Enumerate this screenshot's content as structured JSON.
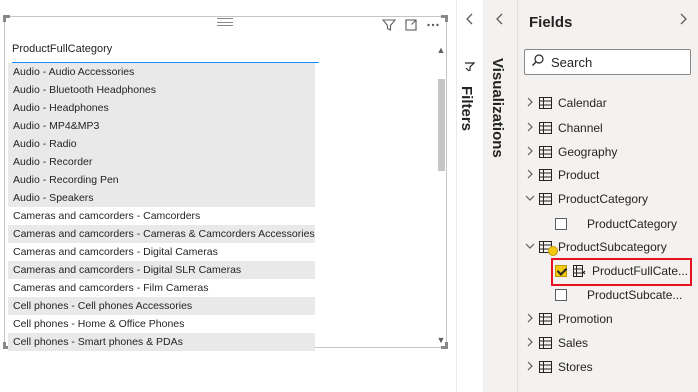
{
  "canvas": {
    "table": {
      "column_header": "ProductFullCategory",
      "rows": [
        "Audio - Audio Accessories",
        "Audio - Bluetooth Headphones",
        "Audio - Headphones",
        "Audio - MP4&MP3",
        "Audio - Radio",
        "Audio - Recorder",
        "Audio - Recording Pen",
        "Audio - Speakers",
        "Cameras and camcorders - Camcorders",
        "Cameras and camcorders - Cameras & Camcorders Accessories",
        "Cameras and camcorders - Digital Cameras",
        "Cameras and camcorders - Digital SLR Cameras",
        "Cameras and camcorders - Film Cameras",
        "Cell phones - Cell phones Accessories",
        "Cell phones - Home & Office Phones",
        "Cell phones - Smart phones & PDAs"
      ]
    },
    "header_icons": [
      "filter-icon",
      "focus-mode-icon",
      "more-options-icon"
    ]
  },
  "filters_pane": {
    "label": "Filters",
    "collapse_icon": "chevron-left-icon"
  },
  "visualizations_pane": {
    "label": "Visualizations",
    "collapse_icon": "chevron-left-icon"
  },
  "fields_pane": {
    "title": "Fields",
    "expand_icon": "chevron-right-icon",
    "search_placeholder": "Search",
    "tables": [
      {
        "name": "Calendar",
        "expanded": false
      },
      {
        "name": "Channel",
        "expanded": false
      },
      {
        "name": "Geography",
        "expanded": false
      },
      {
        "name": "Product",
        "expanded": false
      },
      {
        "name": "ProductCategory",
        "expanded": true,
        "fields": [
          {
            "name": "ProductCategory",
            "checked": false
          }
        ]
      },
      {
        "name": "ProductSubcategory",
        "expanded": true,
        "fields": [
          {
            "name": "ProductFullCate...",
            "checked": true
          },
          {
            "name": "ProductSubcate...",
            "checked": false
          }
        ]
      },
      {
        "name": "Promotion",
        "expanded": false
      },
      {
        "name": "Sales",
        "expanded": false
      },
      {
        "name": "Stores",
        "expanded": false
      }
    ]
  },
  "colors": {
    "accent": "#118dff",
    "checkbox_checked": "#f2c811",
    "highlight": "#e81123",
    "pane_bg": "#f3f2f1"
  }
}
